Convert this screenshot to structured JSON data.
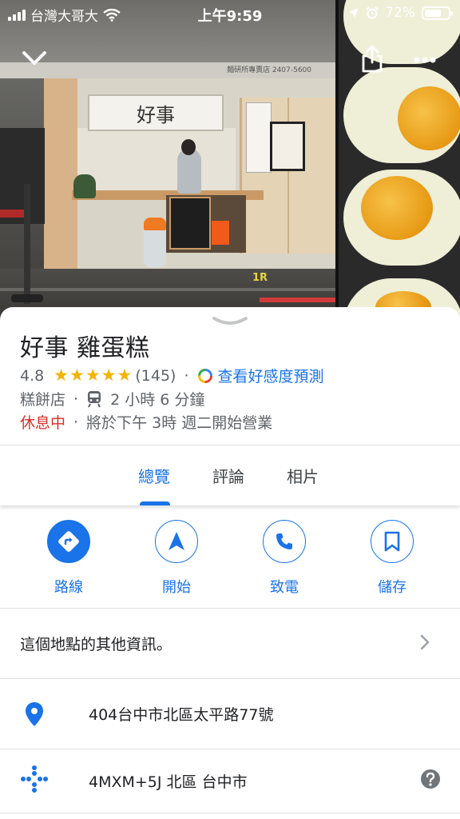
{
  "status_bar": {
    "carrier": "台灣大哥大",
    "time": "上午9:59",
    "battery": "72%",
    "battery_level": 0.72
  },
  "hero": {
    "sign_text": "好事",
    "awning_text": "麵研所專賣店 2407-5600",
    "floor_mark": "1R"
  },
  "place": {
    "name": "好事 雞蛋糕",
    "rating": "4.8",
    "stars": 5,
    "review_count": "(145)",
    "vibe_link": "查看好感度預測",
    "category": "糕餅店",
    "transit_time": "2 小時 6 分鐘",
    "status": "休息中",
    "hours_note": "將於下午 3時 週二開始營業",
    "separator": "·"
  },
  "tabs": [
    {
      "label": "總覽",
      "active": true
    },
    {
      "label": "評論",
      "active": false
    },
    {
      "label": "相片",
      "active": false
    }
  ],
  "actions": [
    {
      "label": "路線",
      "icon": "directions-icon"
    },
    {
      "label": "開始",
      "icon": "navigation-arrow-icon"
    },
    {
      "label": "致電",
      "icon": "phone-icon"
    },
    {
      "label": "儲存",
      "icon": "bookmark-icon"
    }
  ],
  "info": {
    "more_info": "這個地點的其他資訊。",
    "address": "404台中市北區太平路77號",
    "plus_code": "4MXM+5J 北區 台中市"
  },
  "colors": {
    "accent": "#1a73e8",
    "closed": "#d93025",
    "star": "#f4b400"
  }
}
